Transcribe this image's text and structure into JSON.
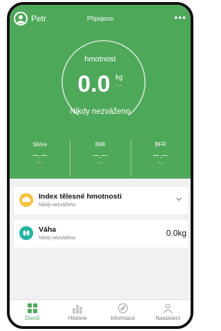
{
  "header": {
    "user_name": "Petr",
    "connection_status": "Připojeno",
    "more_menu": "•••"
  },
  "main_metric": {
    "label": "hmotnost",
    "value": "0.0",
    "unit": "kg",
    "subunit": "--.-",
    "status": "Nikdy nezváženo"
  },
  "stats": [
    {
      "label": "Skóre",
      "value": "--.--",
      "sub": "--.-"
    },
    {
      "label": "BMI",
      "value": "--.--",
      "sub": "--.-"
    },
    {
      "label": "BFR",
      "value": "--.--",
      "sub": "--.-"
    }
  ],
  "cards": [
    {
      "title": "Index tělesné hmotnosti",
      "subtitle": "Nikdy nezváženo",
      "icon": "cloud-icon",
      "color": "#f6c23e"
    },
    {
      "title": "Váha",
      "subtitle": "Nikdy nezváženo",
      "value": "0.0kg",
      "icon": "feet-icon",
      "color": "#21b6a0"
    }
  ],
  "nav": [
    {
      "label": "Domů",
      "icon": "home-grid-icon",
      "active": true
    },
    {
      "label": "Historie",
      "icon": "history-chart-icon",
      "active": false
    },
    {
      "label": "Informace",
      "icon": "compass-icon",
      "active": false
    },
    {
      "label": "Nastavení",
      "icon": "user-icon",
      "active": false
    }
  ],
  "colors": {
    "accent": "#4ea85a",
    "bmi_icon": "#f6c23e",
    "weight_icon": "#21b6a0"
  }
}
